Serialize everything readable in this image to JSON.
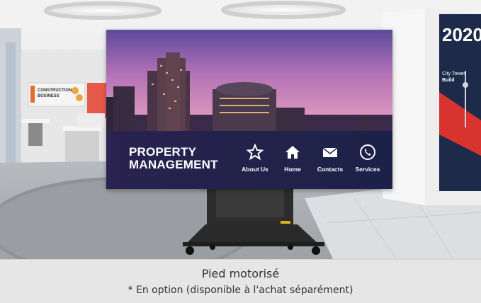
{
  "screen": {
    "heading_line1": "PROPERTY",
    "heading_line2": "MANAGEMENT",
    "menu": [
      {
        "label": "About Us",
        "icon": "star-icon"
      },
      {
        "label": "Home",
        "icon": "home-icon"
      },
      {
        "label": "Contacts",
        "icon": "envelope-icon"
      },
      {
        "label": "Services",
        "icon": "phone-icon"
      }
    ]
  },
  "wall_sign": {
    "line1": "CONSTRUCTION",
    "line2": "BUSINESS"
  },
  "pillar_sign": {
    "year": "2020",
    "line": "City Tower",
    "line2": "Build"
  },
  "caption": {
    "title": "Pied motorisé",
    "subtitle": "* En option (disponible à l'achat séparément)"
  }
}
